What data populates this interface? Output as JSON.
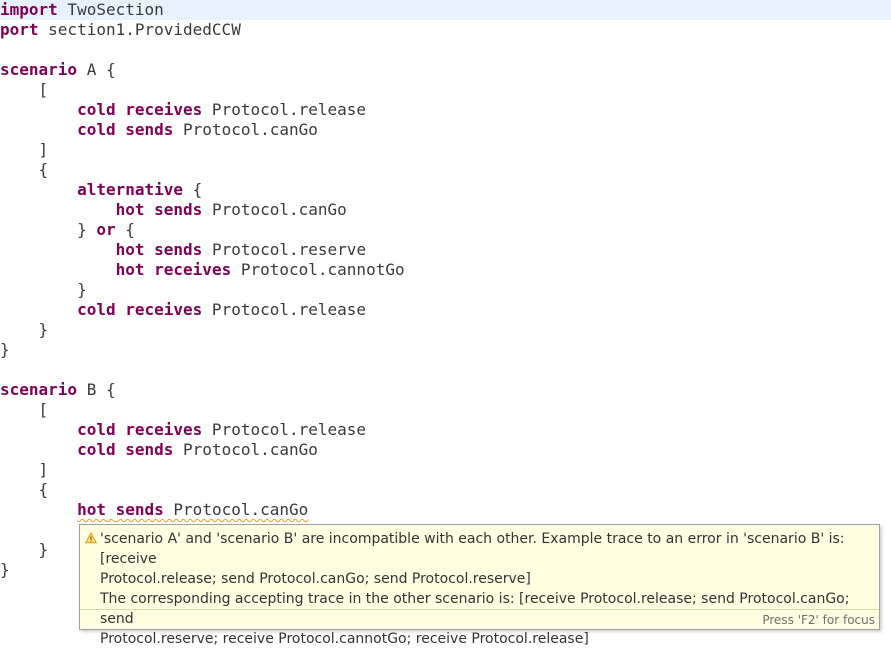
{
  "colors": {
    "keyword": "#7f0055",
    "identifier": "#3a3a3a",
    "current_line": "#e8f2fe",
    "popup_background": "#ffffe1",
    "warning": "#e0a020"
  },
  "editor": {
    "lines": [
      {
        "tokens": [
          {
            "kind": "kw",
            "text": "import"
          },
          {
            "kind": "id",
            "text": " TwoSection"
          }
        ],
        "current": true
      },
      {
        "tokens": [
          {
            "kind": "kw",
            "text": "port"
          },
          {
            "kind": "id",
            "text": " section1.ProvidedCCW"
          }
        ]
      },
      {
        "tokens": []
      },
      {
        "tokens": [
          {
            "kind": "kw",
            "text": "scenario"
          },
          {
            "kind": "id",
            "text": " A {"
          }
        ]
      },
      {
        "tokens": [
          {
            "kind": "id",
            "text": "    ["
          }
        ]
      },
      {
        "tokens": [
          {
            "kind": "id",
            "text": "        "
          },
          {
            "kind": "kw",
            "text": "cold"
          },
          {
            "kind": "id",
            "text": " "
          },
          {
            "kind": "kw",
            "text": "receives"
          },
          {
            "kind": "id",
            "text": " Protocol.release"
          }
        ]
      },
      {
        "tokens": [
          {
            "kind": "id",
            "text": "        "
          },
          {
            "kind": "kw",
            "text": "cold"
          },
          {
            "kind": "id",
            "text": " "
          },
          {
            "kind": "kw",
            "text": "sends"
          },
          {
            "kind": "id",
            "text": " Protocol.canGo"
          }
        ]
      },
      {
        "tokens": [
          {
            "kind": "id",
            "text": "    ]"
          }
        ]
      },
      {
        "tokens": [
          {
            "kind": "id",
            "text": "    {"
          }
        ]
      },
      {
        "tokens": [
          {
            "kind": "id",
            "text": "        "
          },
          {
            "kind": "kw",
            "text": "alternative"
          },
          {
            "kind": "id",
            "text": " {"
          }
        ]
      },
      {
        "tokens": [
          {
            "kind": "id",
            "text": "            "
          },
          {
            "kind": "kw",
            "text": "hot"
          },
          {
            "kind": "id",
            "text": " "
          },
          {
            "kind": "kw",
            "text": "sends"
          },
          {
            "kind": "id",
            "text": " Protocol.canGo"
          }
        ]
      },
      {
        "tokens": [
          {
            "kind": "id",
            "text": "        } "
          },
          {
            "kind": "kw",
            "text": "or"
          },
          {
            "kind": "id",
            "text": " {"
          }
        ]
      },
      {
        "tokens": [
          {
            "kind": "id",
            "text": "            "
          },
          {
            "kind": "kw",
            "text": "hot"
          },
          {
            "kind": "id",
            "text": " "
          },
          {
            "kind": "kw",
            "text": "sends"
          },
          {
            "kind": "id",
            "text": " Protocol.reserve"
          }
        ]
      },
      {
        "tokens": [
          {
            "kind": "id",
            "text": "            "
          },
          {
            "kind": "kw",
            "text": "hot"
          },
          {
            "kind": "id",
            "text": " "
          },
          {
            "kind": "kw",
            "text": "receives"
          },
          {
            "kind": "id",
            "text": " Protocol.cannotGo"
          }
        ]
      },
      {
        "tokens": [
          {
            "kind": "id",
            "text": "        }"
          }
        ]
      },
      {
        "tokens": [
          {
            "kind": "id",
            "text": "        "
          },
          {
            "kind": "kw",
            "text": "cold"
          },
          {
            "kind": "id",
            "text": " "
          },
          {
            "kind": "kw",
            "text": "receives"
          },
          {
            "kind": "id",
            "text": " Protocol.release"
          }
        ]
      },
      {
        "tokens": [
          {
            "kind": "id",
            "text": "    }"
          }
        ]
      },
      {
        "tokens": [
          {
            "kind": "id",
            "text": "}"
          }
        ]
      },
      {
        "tokens": []
      },
      {
        "tokens": [
          {
            "kind": "kw",
            "text": "scenario"
          },
          {
            "kind": "id",
            "text": " B {"
          }
        ]
      },
      {
        "tokens": [
          {
            "kind": "id",
            "text": "    ["
          }
        ]
      },
      {
        "tokens": [
          {
            "kind": "id",
            "text": "        "
          },
          {
            "kind": "kw",
            "text": "cold"
          },
          {
            "kind": "id",
            "text": " "
          },
          {
            "kind": "kw",
            "text": "receives"
          },
          {
            "kind": "id",
            "text": " Protocol.release"
          }
        ]
      },
      {
        "tokens": [
          {
            "kind": "id",
            "text": "        "
          },
          {
            "kind": "kw",
            "text": "cold"
          },
          {
            "kind": "id",
            "text": " "
          },
          {
            "kind": "kw",
            "text": "sends"
          },
          {
            "kind": "id",
            "text": " Protocol.canGo"
          }
        ]
      },
      {
        "tokens": [
          {
            "kind": "id",
            "text": "    ]"
          }
        ]
      },
      {
        "tokens": [
          {
            "kind": "id",
            "text": "    {"
          }
        ]
      },
      {
        "tokens": [
          {
            "kind": "id",
            "text": "        "
          },
          {
            "kind": "kw",
            "text": "hot",
            "err": true
          },
          {
            "kind": "id",
            "text": " ",
            "err": true
          },
          {
            "kind": "kw",
            "text": "sends",
            "err": true
          },
          {
            "kind": "id",
            "text": " Protocol.canGo",
            "err": true
          }
        ]
      },
      {
        "tokens": []
      },
      {
        "tokens": [
          {
            "kind": "id",
            "text": "    }"
          }
        ]
      },
      {
        "tokens": [
          {
            "kind": "id",
            "text": "}"
          }
        ]
      }
    ]
  },
  "popup": {
    "icon": "warning-icon",
    "message_line_1": "'scenario A' and 'scenario B' are incompatible with each other. Example trace to an error in 'scenario B' is: [receive",
    "message_line_2": "Protocol.release; send Protocol.canGo; send Protocol.reserve]",
    "message_line_3": "The corresponding accepting trace in the other scenario is: [receive Protocol.release; send Protocol.canGo; send",
    "message_line_4": "Protocol.reserve; receive Protocol.cannotGo; receive Protocol.release]",
    "focus_hint": "Press 'F2' for focus"
  }
}
